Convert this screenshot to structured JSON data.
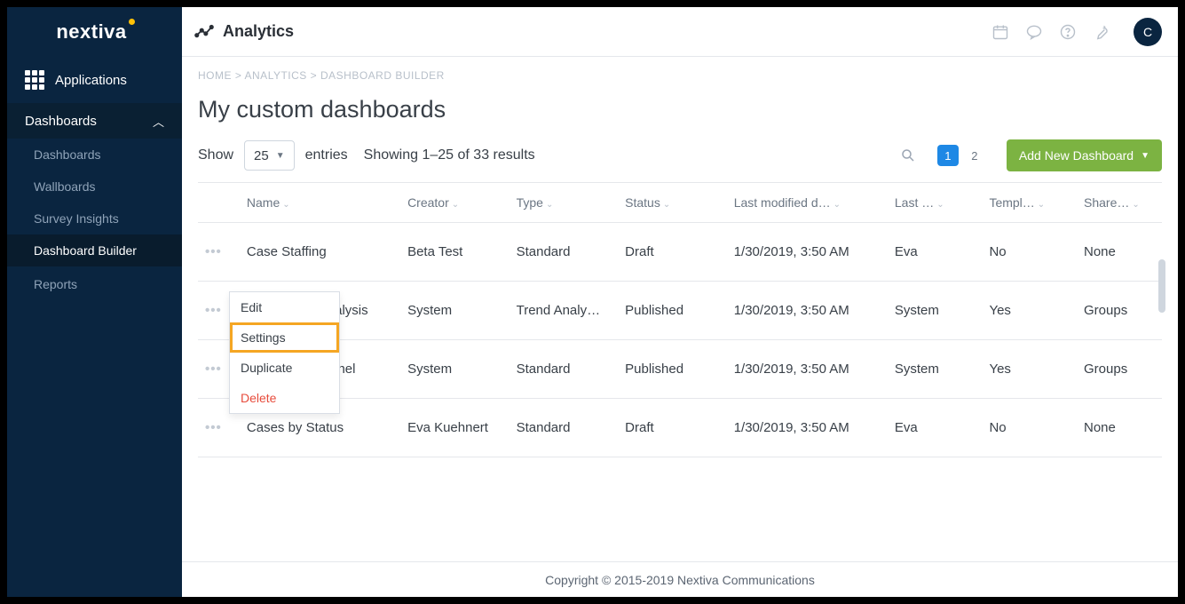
{
  "brand": "nextiva",
  "sidebar": {
    "applications_label": "Applications",
    "section": "Dashboards",
    "items": [
      {
        "label": "Dashboards",
        "active": false
      },
      {
        "label": "Wallboards",
        "active": false
      },
      {
        "label": "Survey Insights",
        "active": false
      },
      {
        "label": "Dashboard Builder",
        "active": true
      }
    ],
    "reports_label": "Reports"
  },
  "header": {
    "title": "Analytics",
    "avatar_initial": "C"
  },
  "breadcrumb": {
    "items": [
      "HOME",
      "ANALYTICS",
      "DASHBOARD BUILDER"
    ],
    "text": "HOME > ANALYTICS > DASHBOARD BUILDER"
  },
  "page": {
    "title": "My custom dashboards"
  },
  "controls": {
    "show_label": "Show",
    "entries_value": "25",
    "entries_suffix": "entries",
    "results_text": "Showing 1–25 of 33 results",
    "pages": [
      "1",
      "2"
    ],
    "active_page": "1",
    "add_button": "Add New Dashboard"
  },
  "table": {
    "columns": [
      "Name",
      "Creator",
      "Type",
      "Status",
      "Last modified d…",
      "Last …",
      "Templ…",
      "Share…"
    ],
    "rows": [
      {
        "name": "Case Staffing",
        "creator": "Beta Test",
        "type": "Standard",
        "status": "Draft",
        "modified": "1/30/2019, 3:50 AM",
        "last_by": "Eva",
        "template": "No",
        "shared": "None"
      },
      {
        "name": "Case Trend Analysis",
        "creator": "System",
        "type": "Trend Analy…",
        "status": "Published",
        "modified": "1/30/2019, 3:50 AM",
        "last_by": "System",
        "template": "Yes",
        "shared": "Groups"
      },
      {
        "name": "Cases by Channel",
        "creator": "System",
        "type": "Standard",
        "status": "Published",
        "modified": "1/30/2019, 3:50 AM",
        "last_by": "System",
        "template": "Yes",
        "shared": "Groups"
      },
      {
        "name": "Cases by Status",
        "creator": "Eva Kuehnert",
        "type": "Standard",
        "status": "Draft",
        "modified": "1/30/2019, 3:50 AM",
        "last_by": "Eva",
        "template": "No",
        "shared": "None"
      }
    ]
  },
  "context_menu": {
    "items": [
      {
        "label": "Edit"
      },
      {
        "label": "Settings",
        "highlight": true
      },
      {
        "label": "Duplicate"
      },
      {
        "label": "Delete",
        "danger": true
      }
    ]
  },
  "footer": {
    "text": "Copyright © 2015-2019 Nextiva Communications"
  }
}
